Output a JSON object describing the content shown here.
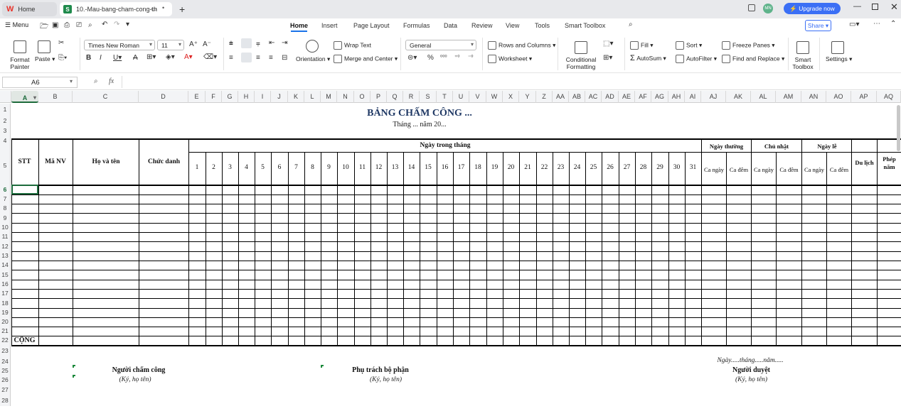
{
  "tabs": {
    "home_label": "Home",
    "doc_title": "10.-Mau-bang-cham-cong-th"
  },
  "window": {
    "user_initials": "MN",
    "upgrade_label": "Upgrade now"
  },
  "menu": {
    "menu_label": "Menu",
    "ribbon_tabs": [
      "Home",
      "Insert",
      "Page Layout",
      "Formulas",
      "Data",
      "Review",
      "View",
      "Tools",
      "Smart Toolbox"
    ],
    "share_label": "Share"
  },
  "ribbon": {
    "format_painter": "Format Painter",
    "paste": "Paste",
    "font_name": "Times New Roman",
    "font_size": "11",
    "wrap_text": "Wrap Text",
    "orientation": "Orientation",
    "merge_center": "Merge and Center",
    "number_format": "General",
    "rows_columns": "Rows and Columns",
    "worksheet": "Worksheet",
    "conditional_formatting": "Conditional Formatting",
    "fill": "Fill",
    "autosum": "AutoSum",
    "sort": "Sort",
    "autofilter": "AutoFilter",
    "freeze_panes": "Freeze Panes",
    "find_replace": "Find and Replace",
    "smart_toolbox": "Smart Toolbox",
    "settings": "Settings"
  },
  "formula_bar": {
    "cell_ref": "A6",
    "fx": "fx",
    "content": ""
  },
  "columns": [
    "A",
    "B",
    "C",
    "D",
    "E",
    "F",
    "G",
    "H",
    "I",
    "J",
    "K",
    "L",
    "M",
    "N",
    "O",
    "P",
    "Q",
    "R",
    "S",
    "T",
    "U",
    "V",
    "W",
    "X",
    "Y",
    "Z",
    "AA",
    "AB",
    "AC",
    "AD",
    "AE",
    "AF",
    "AG",
    "AH",
    "AI",
    "AJ",
    "AK",
    "AL",
    "AM",
    "AN",
    "AO",
    "AP",
    "AQ"
  ],
  "rows": [
    "1",
    "2",
    "3",
    "4",
    "5",
    "6",
    "7",
    "8",
    "9",
    "10",
    "11",
    "12",
    "13",
    "14",
    "15",
    "16",
    "17",
    "18",
    "19",
    "20",
    "21",
    "22",
    "23",
    "24",
    "25",
    "26",
    "27",
    "28"
  ],
  "sheet": {
    "title": "BẢNG CHẤM CÔNG ...",
    "subtitle": "Tháng ... năm 20...",
    "col_stt": "STT",
    "col_manv": "Mã NV",
    "col_hoten": "Họ và tên",
    "col_chucdanh": "Chức danh",
    "col_ngay": "Ngày trong tháng",
    "days": [
      "1",
      "2",
      "3",
      "4",
      "5",
      "6",
      "7",
      "8",
      "9",
      "10",
      "11",
      "12",
      "13",
      "14",
      "15",
      "16",
      "17",
      "18",
      "19",
      "20",
      "21",
      "22",
      "23",
      "24",
      "25",
      "26",
      "27",
      "28",
      "29",
      "30",
      "31"
    ],
    "ngay_thuong": "Ngày thường",
    "chu_nhat": "Chủ nhật",
    "ngay_le": "Ngày lễ",
    "ca_ngay": "Ca ngày",
    "ca_dem": "Ca đêm",
    "du_lich": "Du lịch",
    "phep_nam": "Phép năm",
    "cong": "CỘNG",
    "nguoi_cham_cong": "Người chấm công",
    "phu_trach": "Phụ trách bộ phận",
    "ngay_thang": "Ngày.....tháng.....năm.....",
    "nguoi_duyet": "Người duyệt",
    "ky_ho_ten": "(Ký, họ tên)"
  }
}
